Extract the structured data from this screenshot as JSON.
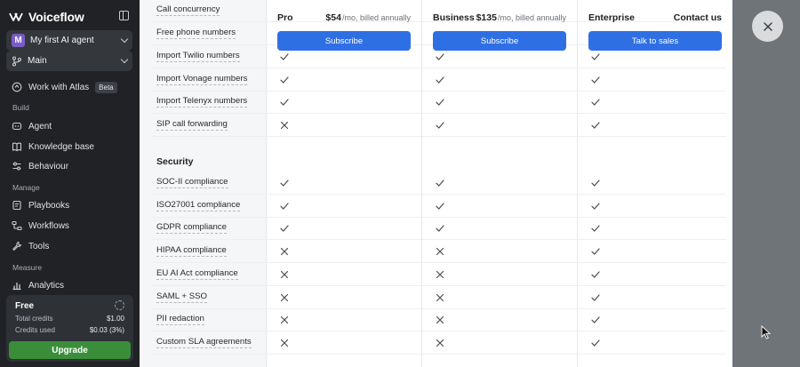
{
  "sidebar": {
    "logo": "Voiceflow",
    "agent_selector": {
      "avatar": "M",
      "label": "My first AI agent"
    },
    "branch_selector": {
      "label": "Main"
    },
    "atlas": {
      "label": "Work with Atlas",
      "badge": "Beta"
    },
    "sections": {
      "build": "Build",
      "manage": "Manage",
      "measure": "Measure"
    },
    "items": {
      "agent": "Agent",
      "knowledge_base": "Knowledge base",
      "behaviour": "Behaviour",
      "playbooks": "Playbooks",
      "workflows": "Workflows",
      "tools": "Tools",
      "analytics": "Analytics"
    },
    "plan_card": {
      "plan": "Free",
      "total_credits_label": "Total credits",
      "total_credits_value": "$1.00",
      "credits_used_label": "Credits used",
      "credits_used_value": "$0.03 (3%)",
      "upgrade_label": "Upgrade"
    }
  },
  "pricing": {
    "plans": {
      "pro": {
        "name": "Pro",
        "price": "$54",
        "period": "/mo, billed annually",
        "cta": "Subscribe"
      },
      "business": {
        "name": "Business",
        "price": "$135",
        "period": "/mo, billed annually",
        "cta": "Subscribe"
      },
      "enterprise": {
        "name": "Enterprise",
        "price": "Contact us",
        "cta": "Talk to sales"
      }
    },
    "features_top": [
      "Call concurrency",
      "Free phone numbers",
      "Import Twilio numbers",
      "Import Vonage numbers",
      "Import Telenyx numbers",
      "SIP call forwarding"
    ],
    "security_title": "Security",
    "security_features": [
      "SOC-II compliance",
      "ISO27001 compliance",
      "GDPR compliance",
      "HIPAA compliance",
      "EU AI Act compliance",
      "SAML + SSO",
      "PII redaction",
      "Custom SLA agreements"
    ],
    "availability_top": [
      [
        "check",
        "check",
        "check"
      ],
      [
        "check",
        "check",
        "check"
      ],
      [
        "check",
        "check",
        "check"
      ],
      [
        "cross",
        "check",
        "check"
      ]
    ],
    "availability_security": [
      [
        "check",
        "check",
        "check"
      ],
      [
        "check",
        "check",
        "check"
      ],
      [
        "check",
        "check",
        "check"
      ],
      [
        "cross",
        "cross",
        "check"
      ],
      [
        "cross",
        "cross",
        "check"
      ],
      [
        "cross",
        "cross",
        "check"
      ],
      [
        "cross",
        "cross",
        "check"
      ],
      [
        "cross",
        "cross",
        "check"
      ]
    ]
  },
  "colors": {
    "sidebar_bg": "#202226",
    "primary_button": "#2f6fe4",
    "upgrade_button": "#3a8e3a",
    "overlay": "#6f7478"
  }
}
